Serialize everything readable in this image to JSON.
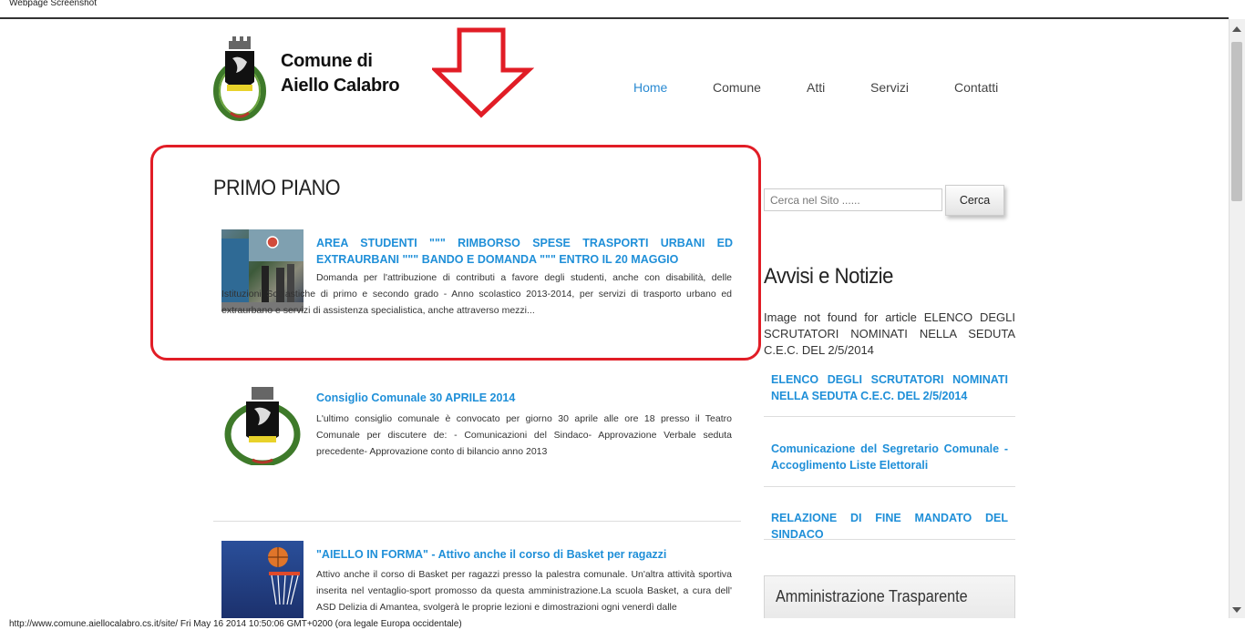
{
  "window": {
    "label": "Webpage Screenshot"
  },
  "status_bar": {
    "text": "http://www.comune.aiellocalabro.cs.it/site/ Fri May 16 2014 10:50:06 GMT+0200 (ora legale Europa occidentale)"
  },
  "header": {
    "logo_line1": "Comune di",
    "logo_line2": "Aiello Calabro",
    "nav": [
      "Home",
      "Comune",
      "Atti",
      "Servizi",
      "Contatti"
    ]
  },
  "main": {
    "section_title": "PRIMO PIANO",
    "articles": [
      {
        "title": "AREA STUDENTI \"\"\" RIMBORSO SPESE TRASPORTI URBANI ED EXTRAURBANI \"\"\" BANDO E DOMANDA \"\"\" ENTRO IL 20 MAGGIO",
        "body": "Domanda per l'attribuzione di contributi a favore degli studenti, anche con disabilità, delle Istituzioni Scolastiche di primo e secondo grado - Anno scolastico 2013-2014, per servizi di trasporto urbano ed extraurbano e servizi di assistenza specialistica, anche attraverso mezzi..."
      },
      {
        "title": "Consiglio Comunale 30 APRILE 2014",
        "body": "L'ultimo consiglio comunale è convocato per giorno 30 aprile alle ore 18 presso il Teatro Comunale per discutere de: - Comunicazioni del Sindaco- Approvazione Verbale seduta precedente- Approvazione conto di bilancio anno 2013"
      },
      {
        "title": "\"AIELLO IN FORMA\" - Attivo anche il corso di Basket per ragazzi",
        "body": "Attivo anche il corso di Basket per ragazzi presso la palestra comunale. Un'altra attività sportiva inserita nel ventaglio-sport promosso da questa amministrazione.La scuola Basket, a cura dell' ASD Delizia di Amantea, svolgerà le proprie lezioni e dimostrazioni ogni venerdì dalle"
      }
    ]
  },
  "sidebar": {
    "search": {
      "placeholder": "Cerca nel Sito ......",
      "button": "Cerca"
    },
    "news_title": "Avvisi e Notizie",
    "image_missing": "Image not found for article ELENCO DEGLI SCRUTATORI NOMINATI NELLA SEDUTA C.E.C. DEL 2/5/2014",
    "links": [
      "ELENCO DEGLI SCRUTATORI NOMINATI NELLA SEDUTA C.E.C. DEL 2/5/2014",
      "Comunicazione del Segretario Comunale - Accoglimento Liste Elettorali",
      "RELAZIONE DI FINE MANDATO DEL SINDACO"
    ],
    "amministrazione": "Amministrazione Trasparente"
  },
  "colors": {
    "link": "#1f8fd8",
    "highlight": "#e11d26",
    "nav_active": "#2a8ad2"
  }
}
